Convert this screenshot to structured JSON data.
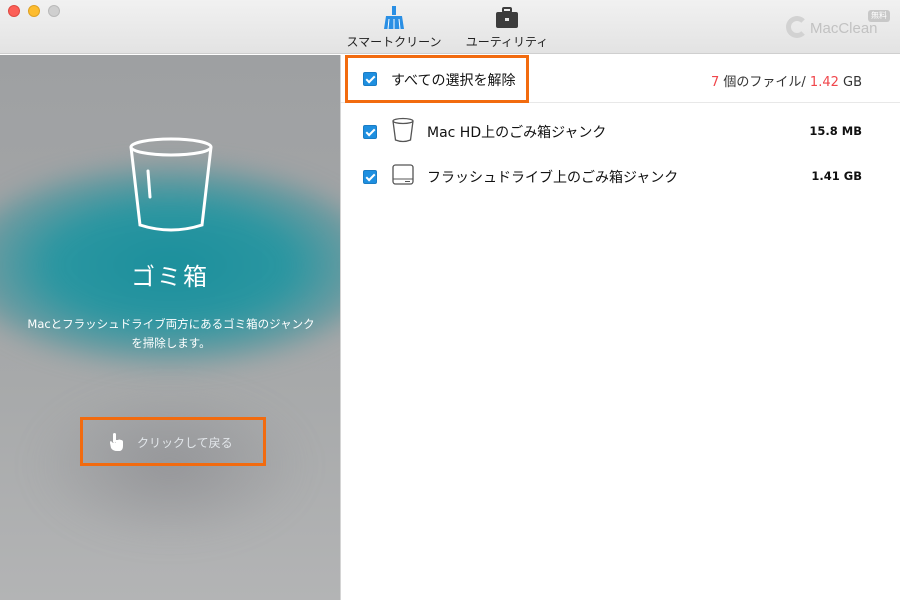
{
  "toolbar": {
    "smart_clean_label": "スマートクリーン",
    "utility_label": "ユーティリティ"
  },
  "brand": {
    "name": "MacClean",
    "badge": "無料"
  },
  "left_panel": {
    "title": "ゴミ箱",
    "description": "Macとフラッシュドライブ両方にあるゴミ箱のジャンクを掃除します。",
    "back_button_label": "クリックして戻る"
  },
  "right_panel": {
    "select_all_label": "すべての選択を解除",
    "summary": {
      "count": "7",
      "count_suffix": " 個のファイル/ ",
      "size": "1.42",
      "size_unit": " GB"
    },
    "items": [
      {
        "name": "Mac HD上のごみ箱ジャンク",
        "size": "15.8 MB",
        "checked": true,
        "icon": "trash-bin-icon"
      },
      {
        "name": "フラッシュドライブ上のごみ箱ジャンク",
        "size": "1.41 GB",
        "checked": true,
        "icon": "drive-icon"
      }
    ]
  },
  "colors": {
    "accent_blue": "#1e8fe0",
    "highlight_orange": "#f26b0f",
    "summary_red": "#f0464b",
    "panel_teal": "#1b8f9c"
  }
}
